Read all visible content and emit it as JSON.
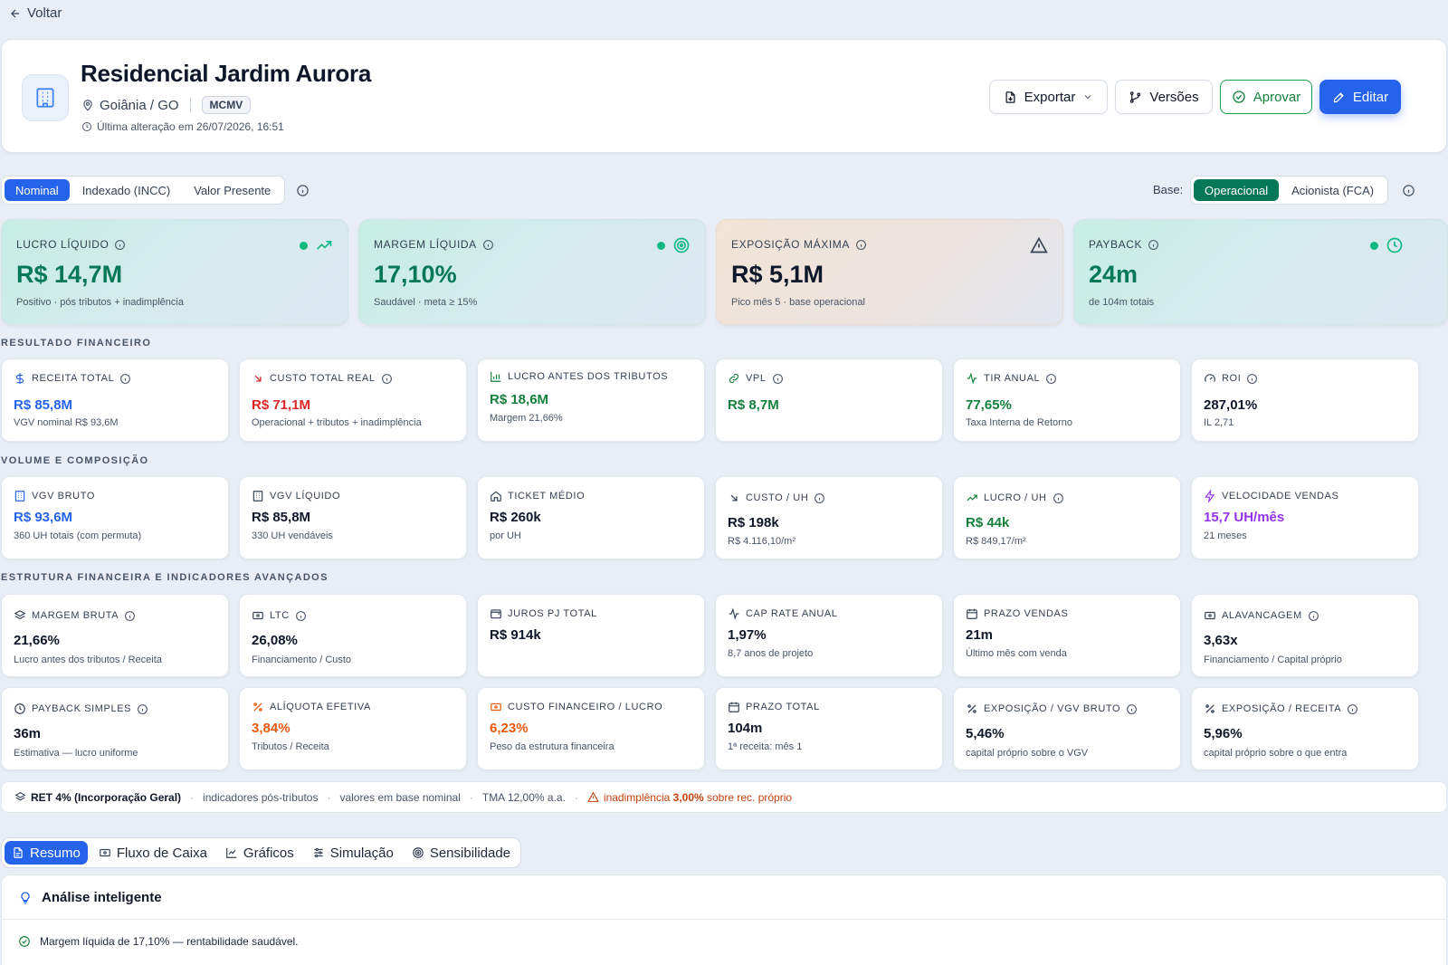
{
  "nav": {
    "back_label": "Voltar"
  },
  "header": {
    "title": "Residencial Jardim Aurora",
    "location": "Goiânia / GO",
    "badge": "MCMV",
    "last_modified": "Última alteração em 26/07/2026, 16:51",
    "buttons": {
      "export": "Exportar",
      "versions": "Versões",
      "approve": "Aprovar",
      "edit": "Editar"
    }
  },
  "view_modes": {
    "options": [
      "Nominal",
      "Indexado (INCC)",
      "Valor Presente"
    ],
    "selected": "Nominal"
  },
  "base": {
    "label": "Base:",
    "options": [
      "Operacional",
      "Acionista (FCA)"
    ],
    "selected": "Operacional"
  },
  "highlights": [
    {
      "label": "LUCRO LÍQUIDO",
      "value": "R$ 14,7M",
      "sub": "Positivo · pós tributos + inadimplência",
      "icon": "trending-up-icon",
      "color": "#047857"
    },
    {
      "label": "MARGEM LÍQUIDA",
      "value": "17,10%",
      "sub": "Saudável · meta ≥ 15%",
      "icon": "target-icon",
      "color": "#047857"
    },
    {
      "label": "EXPOSIÇÃO MÁXIMA",
      "value": "R$ 5,1M",
      "sub": "Pico mês 5 · base operacional",
      "icon": "warning-icon",
      "color": "#0f172a"
    },
    {
      "label": "PAYBACK",
      "value": "24m",
      "sub": "de 104m totais",
      "icon": "clock-icon",
      "color": "#047857"
    }
  ],
  "sections": {
    "resultado": {
      "title": "RESULTADO FINANCEIRO",
      "cards": [
        {
          "label": "RECEITA TOTAL",
          "value": "R$ 85,8M",
          "sub": "VGV nominal R$ 93,6M",
          "icon": "dollar-icon"
        },
        {
          "label": "CUSTO TOTAL REAL",
          "value": "R$ 71,1M",
          "sub": "Operacional + tributos + inadimplência",
          "icon": "arrow-down-right-icon"
        },
        {
          "label": "LUCRO ANTES DOS TRIBUTOS",
          "value": "R$ 18,6M",
          "sub": "Margem 21,66%",
          "icon": "bar-chart-icon"
        },
        {
          "label": "VPL",
          "value": "R$ 8,7M",
          "sub": "",
          "icon": "link-icon"
        },
        {
          "label": "TIR ANUAL",
          "value": "77,65%",
          "sub": "Taxa Interna de Retorno",
          "icon": "activity-icon"
        },
        {
          "label": "ROI",
          "value": "287,01%",
          "sub": "IL 2,71",
          "icon": "gauge-icon"
        }
      ]
    },
    "volume": {
      "title": "VOLUME E COMPOSIÇÃO",
      "cards": [
        {
          "label": "VGV BRUTO",
          "value": "R$ 93,6M",
          "sub": "360 UH totais (com permuta)",
          "icon": "building-icon"
        },
        {
          "label": "VGV LÍQUIDO",
          "value": "R$ 85,8M",
          "sub": "330 UH vendáveis",
          "icon": "building-icon"
        },
        {
          "label": "TICKET MÉDIO",
          "value": "R$ 260k",
          "sub": "por UH",
          "icon": "home-icon"
        },
        {
          "label": "CUSTO / UH",
          "value": "R$ 198k",
          "sub": "R$ 4.116,10/m²",
          "icon": "arrow-down-right-icon"
        },
        {
          "label": "LUCRO / UH",
          "value": "R$ 44k",
          "sub": "R$ 849,17/m²",
          "icon": "trending-up-icon"
        },
        {
          "label": "VELOCIDADE VENDAS",
          "value": "15,7 UH/mês",
          "sub": "21 meses",
          "icon": "zap-icon"
        }
      ]
    },
    "estrutura": {
      "title": "ESTRUTURA FINANCEIRA E INDICADORES AVANÇADOS",
      "cards": [
        {
          "label": "MARGEM BRUTA",
          "value": "21,66%",
          "sub": "Lucro antes dos tributos / Receita",
          "icon": "layers-icon"
        },
        {
          "label": "LTC",
          "value": "26,08%",
          "sub": "Financiamento / Custo",
          "icon": "banknote-icon"
        },
        {
          "label": "JUROS PJ TOTAL",
          "value": "R$ 914k",
          "sub": "",
          "icon": "wallet-icon"
        },
        {
          "label": "CAP RATE ANUAL",
          "value": "1,97%",
          "sub": "8,7 anos de projeto",
          "icon": "activity-icon"
        },
        {
          "label": "PRAZO VENDAS",
          "value": "21m",
          "sub": "Último mês com venda",
          "icon": "calendar-icon"
        },
        {
          "label": "ALAVANCAGEM",
          "value": "3,63x",
          "sub": "Financiamento / Capital próprio",
          "icon": "banknote-icon"
        },
        {
          "label": "PAYBACK SIMPLES",
          "value": "36m",
          "sub": "Estimativa — lucro uniforme",
          "icon": "clock-icon"
        },
        {
          "label": "ALÍQUOTA EFETIVA",
          "value": "3,84%",
          "sub": "Tributos / Receita",
          "icon": "percent-icon"
        },
        {
          "label": "CUSTO FINANCEIRO / LUCRO",
          "value": "6,23%",
          "sub": "Peso da estrutura financeira",
          "icon": "banknote-icon"
        },
        {
          "label": "PRAZO TOTAL",
          "value": "104m",
          "sub": "1ª receita: mês 1",
          "icon": "calendar-icon"
        },
        {
          "label": "EXPOSIÇÃO / VGV BRUTO",
          "value": "5,46%",
          "sub": "capital próprio sobre o VGV",
          "icon": "percent-icon"
        },
        {
          "label": "EXPOSIÇÃO / RECEITA",
          "value": "5,96%",
          "sub": "capital próprio sobre o que entra",
          "icon": "percent-icon"
        }
      ]
    }
  },
  "footer_info": {
    "regime": "RET 4% (Incorporação Geral)",
    "items": [
      "indicadores pós-tributos",
      "valores em base nominal",
      "TMA 12,00% a.a."
    ],
    "warning_prefix": "inadimplência ",
    "warning_value": "3,00%",
    "warning_suffix": " sobre rec. próprio"
  },
  "tabs": {
    "items": [
      "Resumo",
      "Fluxo de Caixa",
      "Gráficos",
      "Simulação",
      "Sensibilidade"
    ],
    "selected": "Resumo"
  },
  "analysis": {
    "title": "Análise inteligente",
    "first_item": "Margem líquida de 17,10% — rentabilidade saudável."
  },
  "colors": {
    "accent": "#2563eb",
    "positive": "#15803d",
    "negative": "#dc2626",
    "warning": "#ea580c",
    "purple": "#9333ea",
    "base_selected": "#047857"
  }
}
